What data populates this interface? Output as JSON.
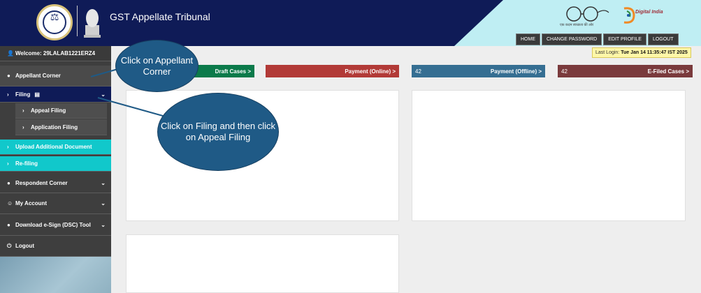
{
  "header": {
    "title": "GST Appellate Tribunal",
    "swachh_text": "एक कदम स्वच्छता की ओर",
    "digital_india": "Digital India",
    "nav": [
      "HOME",
      "CHANGE PASSWORD",
      "EDIT PROFILE",
      "LOGOUT"
    ]
  },
  "sidebar": {
    "welcome": "Welcome: 29LALAB1221ERZ4",
    "appellant": "Appellant Corner",
    "filing": "Filing",
    "appeal_filing": "Appeal Filing",
    "application_filing": "Application Filing",
    "upload": "Upload Additional Document",
    "refiling": "Re-filing",
    "respondent": "Respondent Corner",
    "account": "My Account",
    "dsc": "Download e-Sign (DSC) Tool",
    "logout": "Logout"
  },
  "last_login": {
    "label": "Last Login:",
    "value": "Tue Jan 14 11:35:47 IST 2025"
  },
  "tiles": {
    "draft": "Draft Cases >",
    "payment_online": "Payment (Online) >",
    "payment_offline_count": "42",
    "payment_offline": "Payment (Offline) >",
    "efiled_count": "42",
    "efiled": "E-Filed Cases >"
  },
  "callouts": {
    "one": "Click on Appellant Corner",
    "two": "Click on Filing and then click on Appeal Filing"
  },
  "colors": {
    "header_bg": "#0f1b57",
    "accent_cyan": "#11c8cb",
    "draft": "#0b7a4a",
    "payment_online": "#b23a37",
    "payment_offline": "#356e92",
    "efiled": "#7a3a3c",
    "callout": "#1f5a86"
  }
}
